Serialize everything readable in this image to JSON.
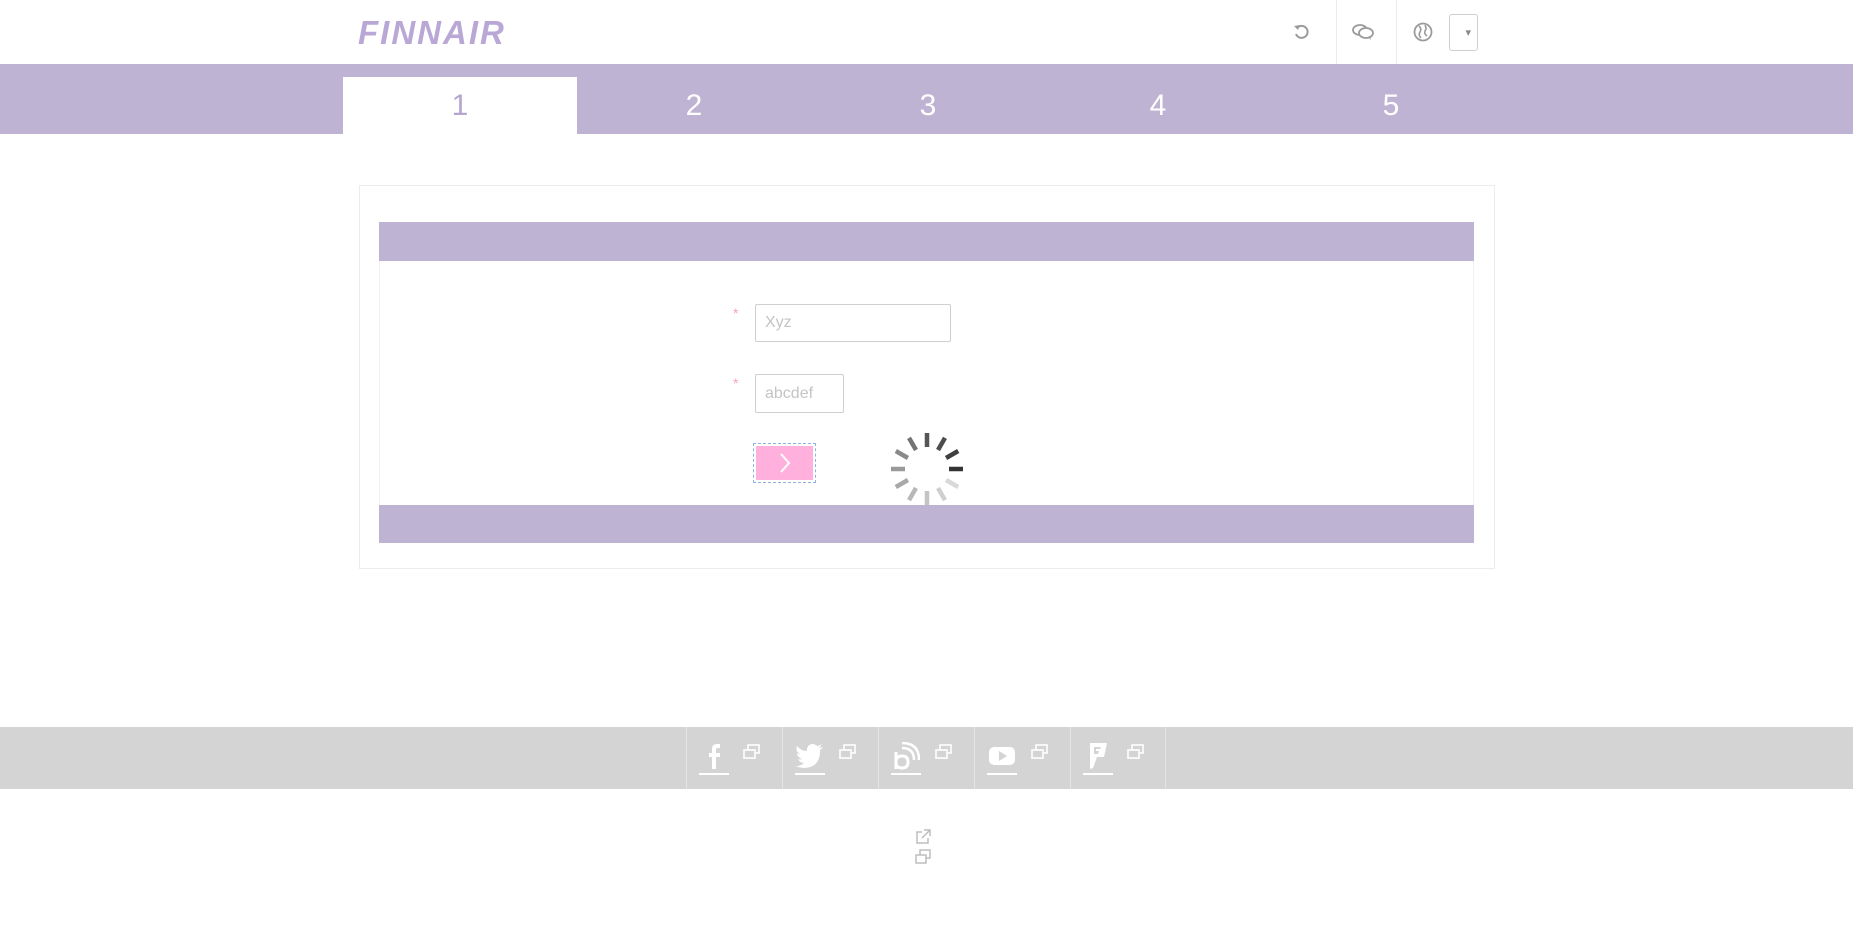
{
  "header": {
    "logo_text": "FINNAIR",
    "icons": [
      "undo-icon",
      "chat-icon",
      "globe-icon"
    ],
    "language_select": {
      "value": "",
      "caret": "▾"
    }
  },
  "steps": [
    {
      "label": "1",
      "active": true
    },
    {
      "label": "2",
      "active": false
    },
    {
      "label": "3",
      "active": false
    },
    {
      "label": "4",
      "active": false
    },
    {
      "label": "5",
      "active": false
    }
  ],
  "form": {
    "required_marker": "*",
    "fields": [
      {
        "placeholder": "Xyz",
        "value": ""
      },
      {
        "placeholder": "abcdef",
        "value": ""
      }
    ],
    "next_button_icon": "chevron-right-icon",
    "loading": true
  },
  "footer": {
    "social": [
      "facebook-icon",
      "twitter-icon",
      "blog-icon",
      "youtube-icon",
      "foursquare-icon"
    ],
    "external_window_icon": "new-window-icon",
    "bottom_links": [
      "external-link-icon",
      "new-window-icon"
    ]
  },
  "colors": {
    "brand_lilac": "#bfb3d4",
    "logo": "#b9a8d6",
    "button_pink": "#ffb0dc",
    "required_pink": "#f7a0c4",
    "footer_gray": "#d4d4d4"
  }
}
